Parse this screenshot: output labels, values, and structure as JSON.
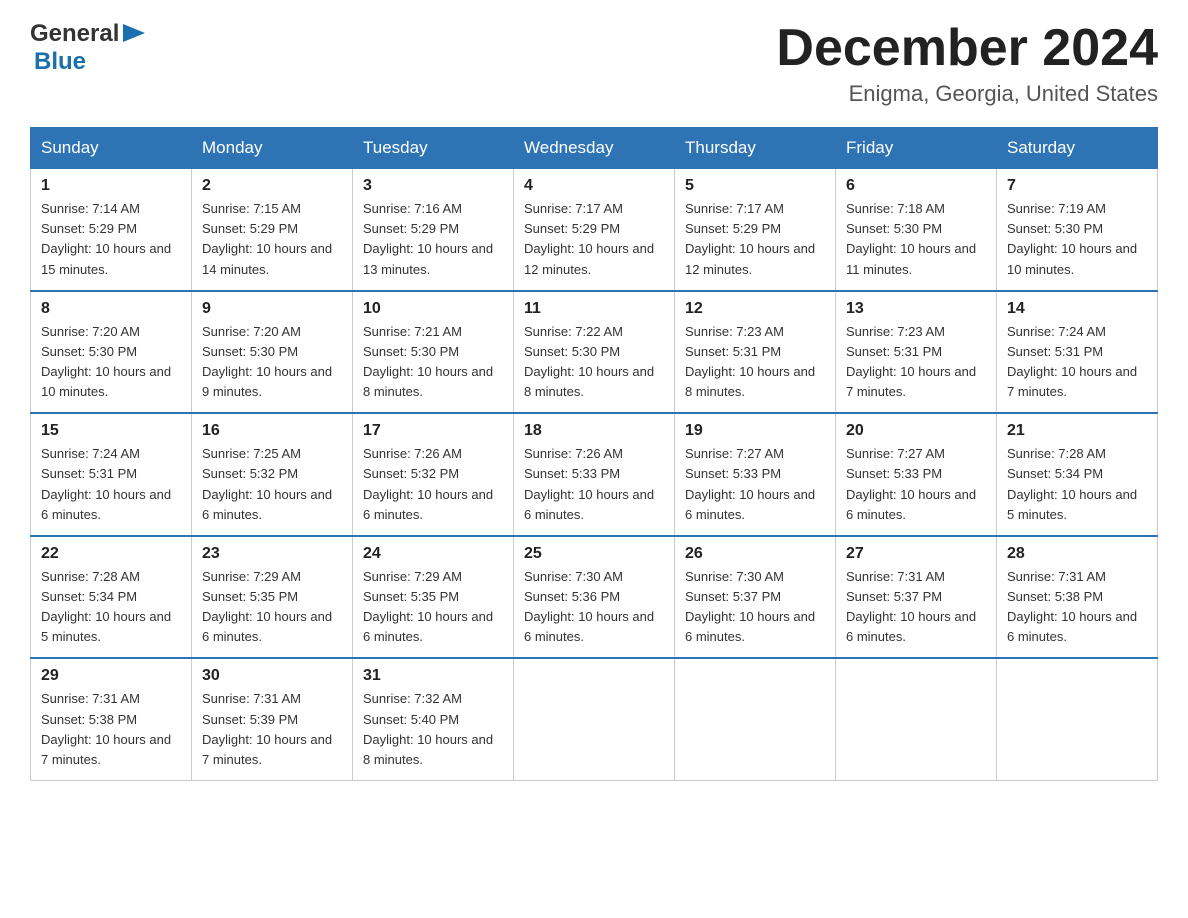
{
  "header": {
    "logo": {
      "general": "General",
      "arrow": "▶",
      "blue": "Blue"
    },
    "title": "December 2024",
    "location": "Enigma, Georgia, United States"
  },
  "weekdays": [
    "Sunday",
    "Monday",
    "Tuesday",
    "Wednesday",
    "Thursday",
    "Friday",
    "Saturday"
  ],
  "weeks": [
    [
      {
        "day": "1",
        "sunrise": "7:14 AM",
        "sunset": "5:29 PM",
        "daylight": "10 hours and 15 minutes."
      },
      {
        "day": "2",
        "sunrise": "7:15 AM",
        "sunset": "5:29 PM",
        "daylight": "10 hours and 14 minutes."
      },
      {
        "day": "3",
        "sunrise": "7:16 AM",
        "sunset": "5:29 PM",
        "daylight": "10 hours and 13 minutes."
      },
      {
        "day": "4",
        "sunrise": "7:17 AM",
        "sunset": "5:29 PM",
        "daylight": "10 hours and 12 minutes."
      },
      {
        "day": "5",
        "sunrise": "7:17 AM",
        "sunset": "5:29 PM",
        "daylight": "10 hours and 12 minutes."
      },
      {
        "day": "6",
        "sunrise": "7:18 AM",
        "sunset": "5:30 PM",
        "daylight": "10 hours and 11 minutes."
      },
      {
        "day": "7",
        "sunrise": "7:19 AM",
        "sunset": "5:30 PM",
        "daylight": "10 hours and 10 minutes."
      }
    ],
    [
      {
        "day": "8",
        "sunrise": "7:20 AM",
        "sunset": "5:30 PM",
        "daylight": "10 hours and 10 minutes."
      },
      {
        "day": "9",
        "sunrise": "7:20 AM",
        "sunset": "5:30 PM",
        "daylight": "10 hours and 9 minutes."
      },
      {
        "day": "10",
        "sunrise": "7:21 AM",
        "sunset": "5:30 PM",
        "daylight": "10 hours and 8 minutes."
      },
      {
        "day": "11",
        "sunrise": "7:22 AM",
        "sunset": "5:30 PM",
        "daylight": "10 hours and 8 minutes."
      },
      {
        "day": "12",
        "sunrise": "7:23 AM",
        "sunset": "5:31 PM",
        "daylight": "10 hours and 8 minutes."
      },
      {
        "day": "13",
        "sunrise": "7:23 AM",
        "sunset": "5:31 PM",
        "daylight": "10 hours and 7 minutes."
      },
      {
        "day": "14",
        "sunrise": "7:24 AM",
        "sunset": "5:31 PM",
        "daylight": "10 hours and 7 minutes."
      }
    ],
    [
      {
        "day": "15",
        "sunrise": "7:24 AM",
        "sunset": "5:31 PM",
        "daylight": "10 hours and 6 minutes."
      },
      {
        "day": "16",
        "sunrise": "7:25 AM",
        "sunset": "5:32 PM",
        "daylight": "10 hours and 6 minutes."
      },
      {
        "day": "17",
        "sunrise": "7:26 AM",
        "sunset": "5:32 PM",
        "daylight": "10 hours and 6 minutes."
      },
      {
        "day": "18",
        "sunrise": "7:26 AM",
        "sunset": "5:33 PM",
        "daylight": "10 hours and 6 minutes."
      },
      {
        "day": "19",
        "sunrise": "7:27 AM",
        "sunset": "5:33 PM",
        "daylight": "10 hours and 6 minutes."
      },
      {
        "day": "20",
        "sunrise": "7:27 AM",
        "sunset": "5:33 PM",
        "daylight": "10 hours and 6 minutes."
      },
      {
        "day": "21",
        "sunrise": "7:28 AM",
        "sunset": "5:34 PM",
        "daylight": "10 hours and 5 minutes."
      }
    ],
    [
      {
        "day": "22",
        "sunrise": "7:28 AM",
        "sunset": "5:34 PM",
        "daylight": "10 hours and 5 minutes."
      },
      {
        "day": "23",
        "sunrise": "7:29 AM",
        "sunset": "5:35 PM",
        "daylight": "10 hours and 6 minutes."
      },
      {
        "day": "24",
        "sunrise": "7:29 AM",
        "sunset": "5:35 PM",
        "daylight": "10 hours and 6 minutes."
      },
      {
        "day": "25",
        "sunrise": "7:30 AM",
        "sunset": "5:36 PM",
        "daylight": "10 hours and 6 minutes."
      },
      {
        "day": "26",
        "sunrise": "7:30 AM",
        "sunset": "5:37 PM",
        "daylight": "10 hours and 6 minutes."
      },
      {
        "day": "27",
        "sunrise": "7:31 AM",
        "sunset": "5:37 PM",
        "daylight": "10 hours and 6 minutes."
      },
      {
        "day": "28",
        "sunrise": "7:31 AM",
        "sunset": "5:38 PM",
        "daylight": "10 hours and 6 minutes."
      }
    ],
    [
      {
        "day": "29",
        "sunrise": "7:31 AM",
        "sunset": "5:38 PM",
        "daylight": "10 hours and 7 minutes."
      },
      {
        "day": "30",
        "sunrise": "7:31 AM",
        "sunset": "5:39 PM",
        "daylight": "10 hours and 7 minutes."
      },
      {
        "day": "31",
        "sunrise": "7:32 AM",
        "sunset": "5:40 PM",
        "daylight": "10 hours and 8 minutes."
      },
      null,
      null,
      null,
      null
    ]
  ]
}
